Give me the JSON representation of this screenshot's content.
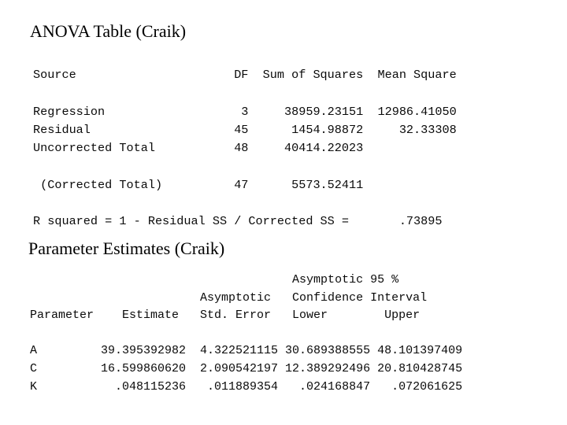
{
  "slide": {
    "background_color": "#ffffff",
    "text_color": "#000000"
  },
  "anova_section": {
    "heading": "ANOVA Table (Craik)",
    "columns": [
      "Source",
      "DF",
      "Sum of Squares",
      "Mean Square"
    ],
    "rows": [
      {
        "source": "Regression",
        "df": "3",
        "sum_of_squares": "38959.23151",
        "mean_square": "12986.41050"
      },
      {
        "source": "Residual",
        "df": "45",
        "sum_of_squares": "1454.98872",
        "mean_square": "32.33308"
      },
      {
        "source": "Uncorrected Total",
        "df": "48",
        "sum_of_squares": "40414.22023",
        "mean_square": ""
      },
      {
        "source": "(Corrected Total)",
        "df": "47",
        "sum_of_squares": "5573.52411",
        "mean_square": ""
      }
    ],
    "r_squared_label": "R squared = 1 - Residual SS / Corrected SS =",
    "r_squared_value": ".73895",
    "text_block": "Source                      DF  Sum of Squares  Mean Square\n\nRegression                   3     38959.23151  12986.41050\nResidual                    45      1454.98872     32.33308\nUncorrected Total           48     40414.22023\n\n (Corrected Total)          47      5573.52411\n\nR squared = 1 - Residual SS / Corrected SS =       .73895"
  },
  "parameter_section": {
    "heading": "Parameter Estimates (Craik)",
    "group_header_line1": "Asymptotic 95 %",
    "group_header_line2": "Confidence Interval",
    "columns": [
      "Parameter",
      "Estimate",
      "Asymptotic Std. Error",
      "Lower",
      "Upper"
    ],
    "rows": [
      {
        "parameter": "A",
        "estimate": "39.395392982",
        "std_error": "4.322521115",
        "lower": "30.689388555",
        "upper": "48.101397409"
      },
      {
        "parameter": "C",
        "estimate": "16.599860620",
        "std_error": "2.090542197",
        "lower": "12.389292496",
        "upper": "20.810428745"
      },
      {
        "parameter": "K",
        "estimate": ".048115236",
        "std_error": ".011889354",
        "lower": ".024168847",
        "upper": ".072061625"
      }
    ],
    "text_block": "                                     Asymptotic 95 %\n                        Asymptotic   Confidence Interval\nParameter    Estimate   Std. Error   Lower        Upper\n\nA         39.395392982  4.322521115 30.689388555 48.101397409\nC         16.599860620  2.090542197 12.389292496 20.810428745\nK           .048115236   .011889354   .024168847   .072061625"
  }
}
